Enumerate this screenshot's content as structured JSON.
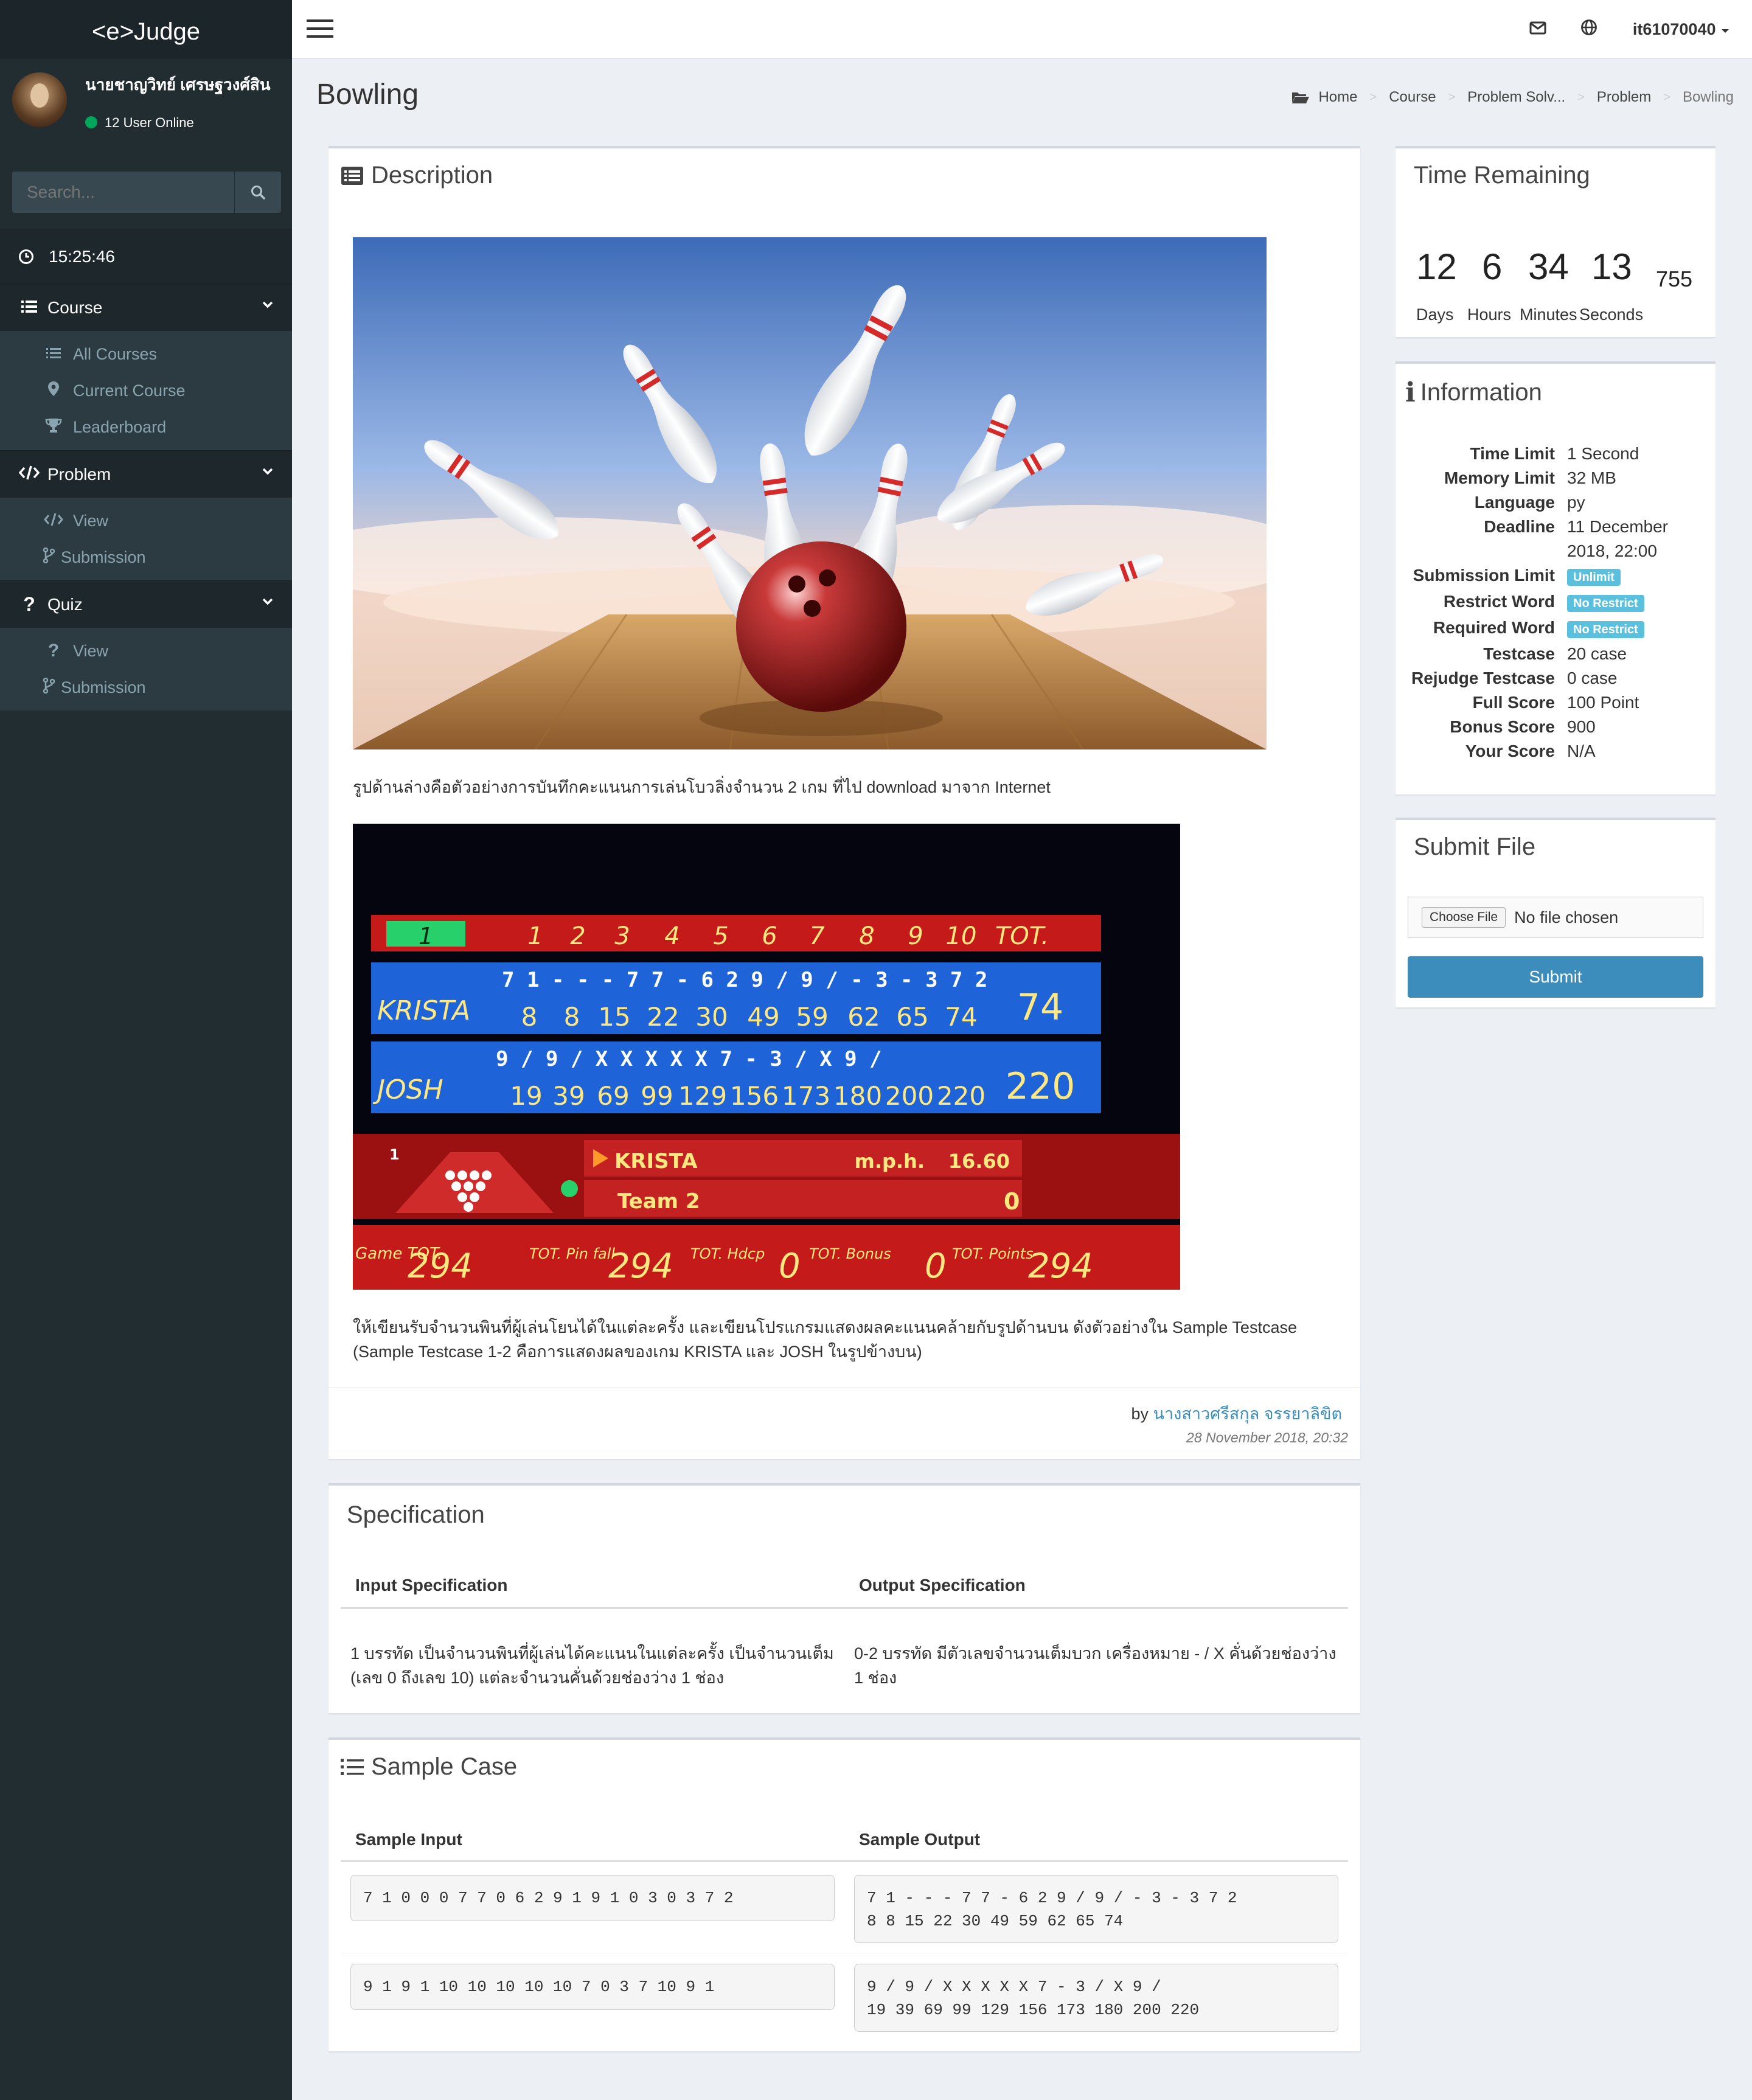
{
  "app": {
    "brand": "<e>Judge"
  },
  "sidebar": {
    "user_name": "นายชาญวิทย์ เศรษฐวงศ์สิน",
    "online_text": "12 User Online",
    "search_placeholder": "Search...",
    "clock": "15:25:46",
    "sections": [
      {
        "label": "Course",
        "icon": "list-icon",
        "items": [
          {
            "label": "All Courses",
            "icon": "list-icon"
          },
          {
            "label": "Current Course",
            "icon": "map-marker-icon"
          },
          {
            "label": "Leaderboard",
            "icon": "trophy-icon"
          }
        ]
      },
      {
        "label": "Problem",
        "icon": "code-icon",
        "items": [
          {
            "label": "View",
            "icon": "code-icon"
          },
          {
            "label": "Submission",
            "icon": "code-fork-icon"
          }
        ]
      },
      {
        "label": "Quiz",
        "icon": "question-icon",
        "items": [
          {
            "label": "View",
            "icon": "question-icon"
          },
          {
            "label": "Submission",
            "icon": "code-fork-icon"
          }
        ]
      }
    ]
  },
  "topbar": {
    "username": "it61070040"
  },
  "page": {
    "title": "Bowling"
  },
  "breadcrumb": [
    "Home",
    "Course",
    "Problem Solv...",
    "Problem",
    "Bowling"
  ],
  "description": {
    "title": "Description",
    "text1": "รูปด้านล่างคือตัวอย่างการบันทึกคะแนนการเล่นโบวลิ่งจำนวน 2 เกม ที่ไป download  มาจาก Internet",
    "text2a": "ให้เขียนรับจำนวนพินที่ผู้เล่นโยนได้ในแต่ละครั้ง และเขียนโปรแกรมแสดงผลคะแนนคล้ายกับรูปด้านบน ดังตัวอย่างใน Sample Testcase",
    "text2b": "(Sample Testcase 1-2 คือการแสดงผลของเกม KRISTA และ JOSH ในรูปข้างบน)",
    "by_prefix": "by",
    "author": "นางสาวศรีสกุล จรรยาลิขิต",
    "date": "28 November 2018, 20:32"
  },
  "scoreboard": {
    "frames": [
      "1",
      "1",
      "2",
      "3",
      "4",
      "5",
      "6",
      "7",
      "8",
      "9",
      "10",
      "TOT."
    ],
    "krista": {
      "name": "KRISTA",
      "rolls": "7 1  - - - 7 7 - 6 2 9 / 9 / - 3 - 3 7 2",
      "scores": [
        "8",
        "8",
        "15",
        "22",
        "30",
        "49",
        "59",
        "62",
        "65",
        "74"
      ],
      "total": "74"
    },
    "josh": {
      "name": "JOSH",
      "rolls": "9 / 9 /  X  X  X  X  X 7 - 3 / X 9 /",
      "scores": [
        "19",
        "39",
        "69",
        "99",
        "129",
        "156",
        "173",
        "180",
        "200",
        "220"
      ],
      "total": "220"
    },
    "current": "KRISTA",
    "team": "Team 2",
    "speed_label": "m.p.h.",
    "speed": "16.60",
    "team_score": "0",
    "frame_no": "1",
    "bottom": [
      {
        "label": "Game TOT.",
        "value": "294"
      },
      {
        "label": "TOT. Pin fall",
        "value": "294"
      },
      {
        "label": "TOT. Hdcp",
        "value": "0"
      },
      {
        "label": "TOT. Bonus",
        "value": "0"
      },
      {
        "label": "TOT. Points",
        "value": "294"
      }
    ]
  },
  "specification": {
    "title": "Specification",
    "input_header": "Input Specification",
    "output_header": "Output Specification",
    "input_text_1": "1 บรรทัด เป็นจำนวนพินที่ผู้เล่นได้คะแนนในแต่ละครั้ง เป็นจำนวนเต็ม",
    "input_text_2": "(เลข 0 ถึงเลข 10) แต่ละจำนวนคั่นด้วยช่องว่าง 1 ช่อง",
    "output_text_1": "0-2 บรรทัด มีตัวเลขจำนวนเต็มบวก เครื่องหมาย - / X คั่นด้วยช่องว่าง",
    "output_text_2": "1 ช่อง"
  },
  "sample": {
    "title": "Sample Case",
    "input_header": "Sample Input",
    "output_header": "Sample Output",
    "cases": [
      {
        "input": "7 1 0 0 0 7 7 0 6 2 9 1 9 1 0 3 0 3 7 2",
        "output": "7 1 - - - 7 7 - 6 2 9 / 9 / - 3 - 3 7 2\n8 8 15 22 30 49 59 62 65 74"
      },
      {
        "input": "9 1 9 1 10 10 10 10 10 7 0 3 7 10 9 1",
        "output": "9 / 9 / X X X X X 7 - 3 / X 9 /\n19 39 69 99 129 156 173 180 200 220"
      }
    ]
  },
  "time_remaining": {
    "title": "Time Remaining",
    "days": "12",
    "hours": "6",
    "minutes": "34",
    "seconds": "13",
    "ms": "755",
    "days_label": "Days",
    "hours_label": "Hours",
    "minutes_label": "Minutes",
    "seconds_label": "Seconds"
  },
  "information": {
    "title": "Information",
    "rows": [
      {
        "key": "Time Limit",
        "value": "1 Second"
      },
      {
        "key": "Memory Limit",
        "value": "32 MB"
      },
      {
        "key": "Language",
        "value": "py"
      },
      {
        "key": "Deadline",
        "value": "11 December",
        "value2": "2018, 22:00"
      },
      {
        "key": "Submission Limit",
        "badge": "Unlimit"
      },
      {
        "key": "Restrict Word",
        "badge": "No Restrict"
      },
      {
        "key": "Required Word",
        "badge": "No Restrict"
      },
      {
        "key": "Testcase",
        "value": "20 case"
      },
      {
        "key": "Rejudge Testcase",
        "value": "0 case"
      },
      {
        "key": "Full Score",
        "value": "100 Point"
      },
      {
        "key": "Bonus Score",
        "value": "900"
      },
      {
        "key": "Your Score",
        "value": "N/A"
      }
    ]
  },
  "submit": {
    "title": "Submit File",
    "choose_label": "Choose File",
    "no_file": "No file chosen",
    "submit_label": "Submit"
  },
  "colors": {
    "sidebar": "#222d32",
    "accent": "#3c8dbc",
    "badge": "#5bc0de",
    "online": "#00a65a"
  }
}
